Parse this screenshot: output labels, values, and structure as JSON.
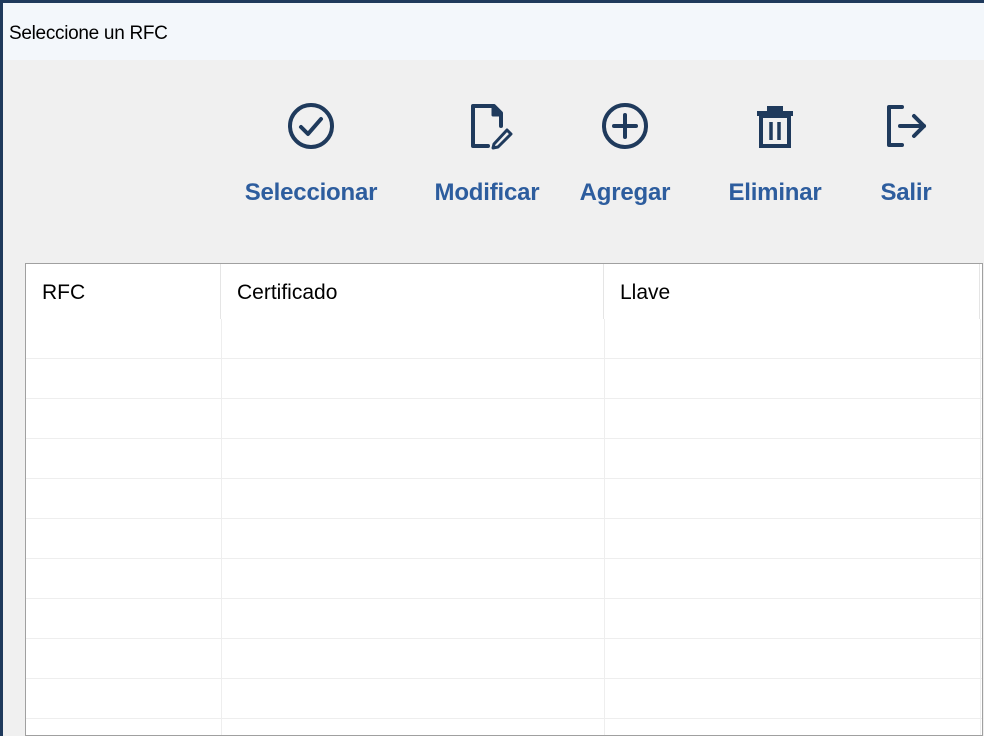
{
  "window": {
    "title": "Seleccione un RFC"
  },
  "toolbar": {
    "buttons": [
      {
        "label": "Seleccionar",
        "icon": "check-circle-icon"
      },
      {
        "label": "Modificar",
        "icon": "document-edit-icon"
      },
      {
        "label": "Agregar",
        "icon": "plus-circle-icon"
      },
      {
        "label": "Eliminar",
        "icon": "trash-icon"
      },
      {
        "label": "Salir",
        "icon": "exit-icon"
      }
    ]
  },
  "grid": {
    "columns": [
      "RFC",
      "Certificado",
      "Llave"
    ],
    "rows": []
  },
  "colors": {
    "accent": "#2d5d9e",
    "icon": "#1f3a5c",
    "frame": "#1f3a5c"
  }
}
